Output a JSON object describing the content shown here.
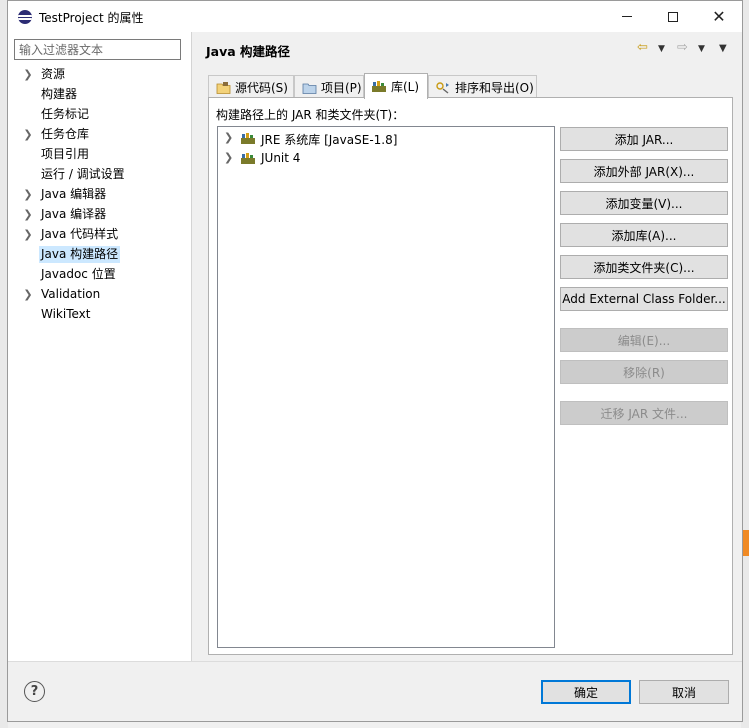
{
  "window": {
    "title": "TestProject 的属性"
  },
  "sidebar": {
    "filter_placeholder": "输入过滤器文本",
    "items": [
      {
        "label": "资源",
        "expandable": true
      },
      {
        "label": "构建器",
        "expandable": false
      },
      {
        "label": "任务标记",
        "expandable": false
      },
      {
        "label": "任务仓库",
        "expandable": true
      },
      {
        "label": "项目引用",
        "expandable": false
      },
      {
        "label": "运行 / 调试设置",
        "expandable": false
      },
      {
        "label": "Java 编辑器",
        "expandable": true
      },
      {
        "label": "Java 编译器",
        "expandable": true
      },
      {
        "label": "Java 代码样式",
        "expandable": true
      },
      {
        "label": "Java 构建路径",
        "expandable": false,
        "selected": true
      },
      {
        "label": "Javadoc 位置",
        "expandable": false
      },
      {
        "label": "Validation",
        "expandable": true
      },
      {
        "label": "WikiText",
        "expandable": false
      }
    ]
  },
  "page": {
    "title": "Java 构建路径",
    "tabs": [
      {
        "label": "源代码(S)",
        "icon": "source-folder-icon"
      },
      {
        "label": "项目(P)",
        "icon": "project-icon"
      },
      {
        "label": "库(L)",
        "icon": "library-icon",
        "active": true
      },
      {
        "label": "排序和导出(O)",
        "icon": "order-export-icon"
      }
    ],
    "tree_caption": "构建路径上的 JAR 和类文件夹(T)：",
    "libraries": [
      {
        "label": "JRE 系统库 [JavaSE-1.8]"
      },
      {
        "label": "JUnit 4"
      }
    ],
    "buttons": {
      "add_jar": "添加 JAR...",
      "add_external_jar": "添加外部 JAR(X)...",
      "add_variable": "添加变量(V)...",
      "add_library": "添加库(A)...",
      "add_class_folder": "添加类文件夹(C)...",
      "add_external_class_folder": "Add External Class Folder...",
      "edit": "编辑(E)...",
      "remove": "移除(R)",
      "migrate_jar": "迁移 JAR 文件..."
    }
  },
  "footer": {
    "help": "?",
    "ok": "确定",
    "cancel": "取消"
  },
  "colors": {
    "selection": "#cce8ff",
    "default_button_border": "#0078d7"
  }
}
